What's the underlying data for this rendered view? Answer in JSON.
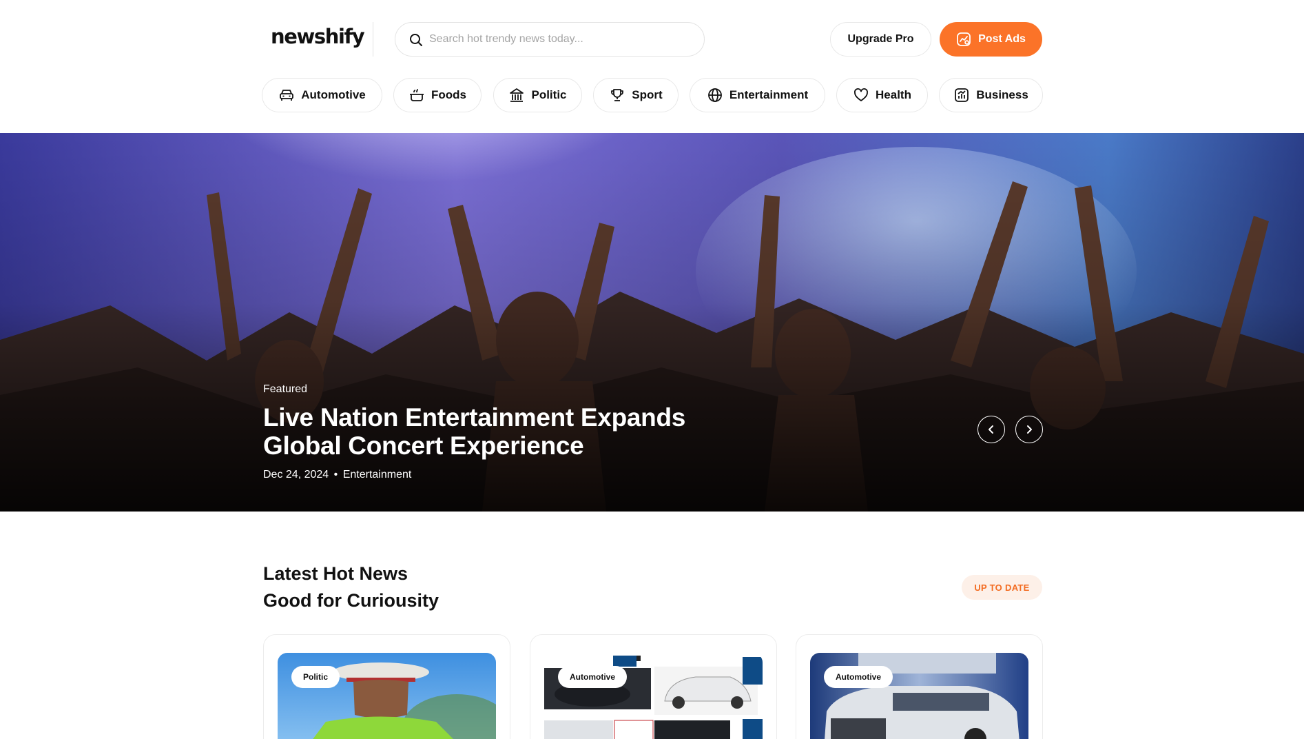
{
  "header": {
    "logo": "newshify",
    "search_placeholder": "Search hot trendy news today...",
    "upgrade_label": "Upgrade Pro",
    "post_ads_label": "Post Ads"
  },
  "categories": [
    {
      "label": "Automotive",
      "icon": "car-icon"
    },
    {
      "label": "Foods",
      "icon": "pot-icon"
    },
    {
      "label": "Politic",
      "icon": "government-building-icon"
    },
    {
      "label": "Sport",
      "icon": "trophy-icon"
    },
    {
      "label": "Entertainment",
      "icon": "globe-icon"
    },
    {
      "label": "Health",
      "icon": "heart-icon"
    },
    {
      "label": "Business",
      "icon": "chart-icon"
    }
  ],
  "hero": {
    "label": "Featured",
    "title": "Live Nation Entertainment Expands Global Concert Experience",
    "date": "Dec 24, 2024",
    "separator": "•",
    "category": "Entertainment"
  },
  "latest": {
    "title_line1": "Latest Hot News",
    "title_line2": "Good for Curiousity",
    "badge": "UP TO DATE"
  },
  "cards": [
    {
      "category": "Politic"
    },
    {
      "category": "Automotive"
    },
    {
      "category": "Automotive"
    }
  ],
  "colors": {
    "accent": "#fb7328",
    "badge_bg": "#fdf0e8",
    "badge_text": "#f36c22"
  }
}
